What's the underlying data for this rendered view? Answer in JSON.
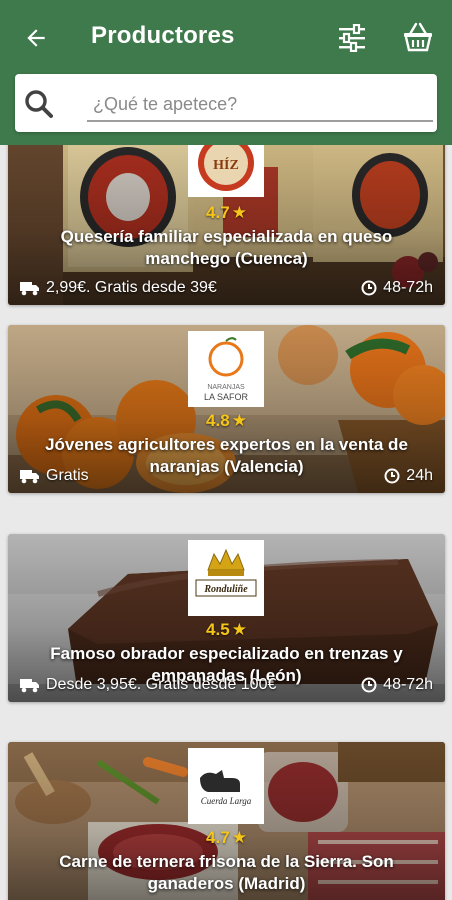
{
  "header": {
    "title": "Productores",
    "back_icon": "arrow-left-icon",
    "filter_icon": "sliders-icon",
    "basket_icon": "basket-icon",
    "background": "#3f7a4c"
  },
  "search": {
    "placeholder": "¿Qué te apetece?",
    "value": ""
  },
  "accent": {
    "star": "#f5c518"
  },
  "producers": [
    {
      "logo_text": "HÍZ",
      "rating": "4.7",
      "description": "Quesería familiar especializada en queso manchego (Cuenca)",
      "shipping": "2,99€. Gratis desde 39€",
      "delivery_time": "48-72h"
    },
    {
      "logo_text_top": "NARANJAS",
      "logo_text_bottom": "LA SAFOR",
      "rating": "4.8",
      "description": "Jóvenes agricultores expertos en la venta de naranjas (Valencia)",
      "shipping": "Gratis",
      "delivery_time": "24h"
    },
    {
      "logo_text": "Ronduliñe",
      "rating": "4.5",
      "description": "Famoso obrador especializado en trenzas y empanadas (León)",
      "shipping": "Desde 3,95€. Gratis desde 100€",
      "delivery_time": "48-72h"
    },
    {
      "logo_text": "Cuerda Larga",
      "rating": "4.7",
      "description": "Carne de ternera frisona de la Sierra. Son ganaderos (Madrid)",
      "shipping": "",
      "delivery_time": ""
    }
  ]
}
